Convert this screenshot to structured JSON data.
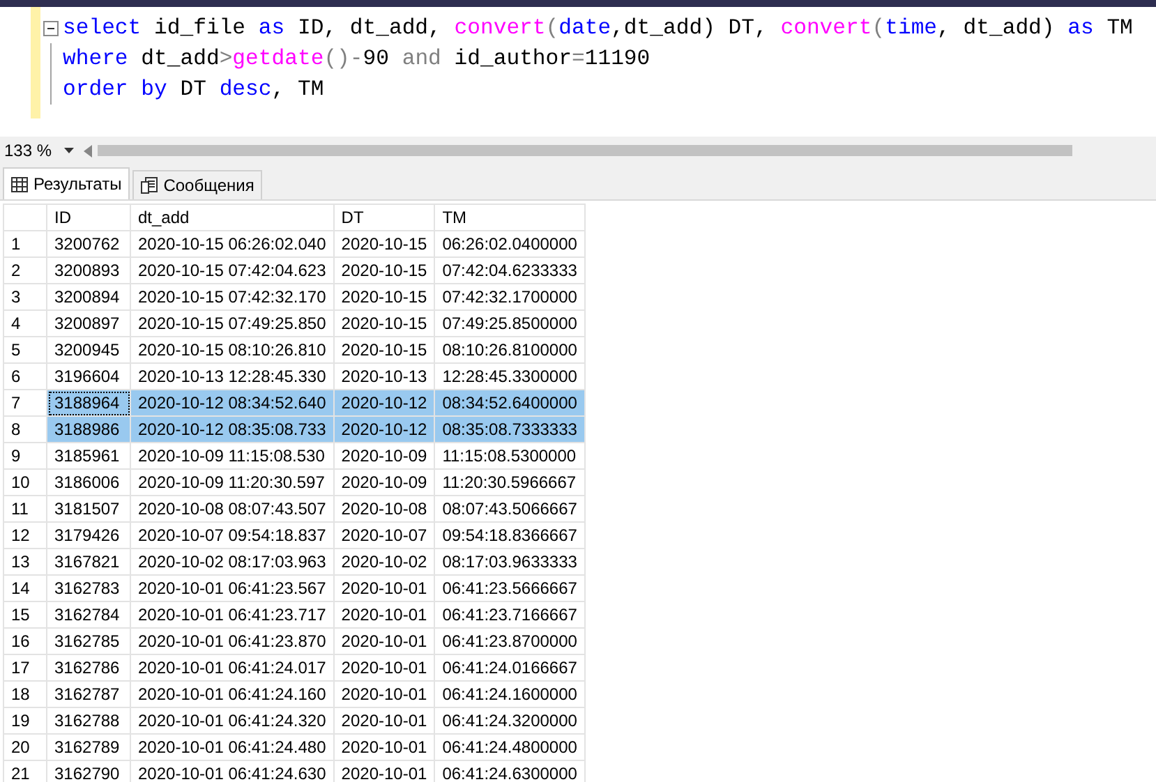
{
  "editor": {
    "lines": [
      {
        "collapsible": true,
        "tokens": [
          {
            "kind": "keyword",
            "text": "select"
          },
          {
            "kind": "plain",
            "text": " id_file "
          },
          {
            "kind": "keyword",
            "text": "as"
          },
          {
            "kind": "plain",
            "text": " ID, dt_add, "
          },
          {
            "kind": "function",
            "text": "convert"
          },
          {
            "kind": "operator",
            "text": "("
          },
          {
            "kind": "keyword",
            "text": "date"
          },
          {
            "kind": "plain",
            "text": ",dt_add) DT, "
          },
          {
            "kind": "function",
            "text": "convert"
          },
          {
            "kind": "operator",
            "text": "("
          },
          {
            "kind": "keyword",
            "text": "time"
          },
          {
            "kind": "plain",
            "text": ", dt_add) "
          },
          {
            "kind": "keyword",
            "text": "as"
          },
          {
            "kind": "plain",
            "text": " TM"
          }
        ]
      },
      {
        "collapsible": false,
        "tokens": [
          {
            "kind": "keyword",
            "text": "where"
          },
          {
            "kind": "plain",
            "text": " dt_add"
          },
          {
            "kind": "operator",
            "text": ">"
          },
          {
            "kind": "function",
            "text": "getdate"
          },
          {
            "kind": "operator",
            "text": "()-"
          },
          {
            "kind": "plain",
            "text": "90 "
          },
          {
            "kind": "operator",
            "text": "and"
          },
          {
            "kind": "plain",
            "text": " id_author"
          },
          {
            "kind": "operator",
            "text": "="
          },
          {
            "kind": "plain",
            "text": "11190"
          }
        ]
      },
      {
        "collapsible": false,
        "tokens": [
          {
            "kind": "keyword",
            "text": "order by"
          },
          {
            "kind": "plain",
            "text": " DT "
          },
          {
            "kind": "keyword",
            "text": "desc"
          },
          {
            "kind": "plain",
            "text": ", TM"
          }
        ]
      }
    ]
  },
  "zoom": {
    "value": "133 %"
  },
  "tabs": [
    {
      "label": "Результаты",
      "selected": true,
      "kind": "grid"
    },
    {
      "label": "Сообщения",
      "selected": false,
      "kind": "messages"
    }
  ],
  "table": {
    "columns": [
      "ID",
      "dt_add",
      "DT",
      "TM"
    ],
    "rows": [
      {
        "n": "1",
        "cells": [
          "3200762",
          "2020-10-15 06:26:02.040",
          "2020-10-15",
          "06:26:02.0400000"
        ],
        "selected": false,
        "focused": false
      },
      {
        "n": "2",
        "cells": [
          "3200893",
          "2020-10-15 07:42:04.623",
          "2020-10-15",
          "07:42:04.6233333"
        ],
        "selected": false,
        "focused": false
      },
      {
        "n": "3",
        "cells": [
          "3200894",
          "2020-10-15 07:42:32.170",
          "2020-10-15",
          "07:42:32.1700000"
        ],
        "selected": false,
        "focused": false
      },
      {
        "n": "4",
        "cells": [
          "3200897",
          "2020-10-15 07:49:25.850",
          "2020-10-15",
          "07:49:25.8500000"
        ],
        "selected": false,
        "focused": false
      },
      {
        "n": "5",
        "cells": [
          "3200945",
          "2020-10-15 08:10:26.810",
          "2020-10-15",
          "08:10:26.8100000"
        ],
        "selected": false,
        "focused": false
      },
      {
        "n": "6",
        "cells": [
          "3196604",
          "2020-10-13 12:28:45.330",
          "2020-10-13",
          "12:28:45.3300000"
        ],
        "selected": false,
        "focused": false
      },
      {
        "n": "7",
        "cells": [
          "3188964",
          "2020-10-12 08:34:52.640",
          "2020-10-12",
          "08:34:52.6400000"
        ],
        "selected": true,
        "focused": true
      },
      {
        "n": "8",
        "cells": [
          "3188986",
          "2020-10-12 08:35:08.733",
          "2020-10-12",
          "08:35:08.7333333"
        ],
        "selected": true,
        "focused": false
      },
      {
        "n": "9",
        "cells": [
          "3185961",
          "2020-10-09 11:15:08.530",
          "2020-10-09",
          "11:15:08.5300000"
        ],
        "selected": false,
        "focused": false
      },
      {
        "n": "10",
        "cells": [
          "3186006",
          "2020-10-09 11:20:30.597",
          "2020-10-09",
          "11:20:30.5966667"
        ],
        "selected": false,
        "focused": false
      },
      {
        "n": "11",
        "cells": [
          "3181507",
          "2020-10-08 08:07:43.507",
          "2020-10-08",
          "08:07:43.5066667"
        ],
        "selected": false,
        "focused": false
      },
      {
        "n": "12",
        "cells": [
          "3179426",
          "2020-10-07 09:54:18.837",
          "2020-10-07",
          "09:54:18.8366667"
        ],
        "selected": false,
        "focused": false
      },
      {
        "n": "13",
        "cells": [
          "3167821",
          "2020-10-02 08:17:03.963",
          "2020-10-02",
          "08:17:03.9633333"
        ],
        "selected": false,
        "focused": false
      },
      {
        "n": "14",
        "cells": [
          "3162783",
          "2020-10-01 06:41:23.567",
          "2020-10-01",
          "06:41:23.5666667"
        ],
        "selected": false,
        "focused": false
      },
      {
        "n": "15",
        "cells": [
          "3162784",
          "2020-10-01 06:41:23.717",
          "2020-10-01",
          "06:41:23.7166667"
        ],
        "selected": false,
        "focused": false
      },
      {
        "n": "16",
        "cells": [
          "3162785",
          "2020-10-01 06:41:23.870",
          "2020-10-01",
          "06:41:23.8700000"
        ],
        "selected": false,
        "focused": false
      },
      {
        "n": "17",
        "cells": [
          "3162786",
          "2020-10-01 06:41:24.017",
          "2020-10-01",
          "06:41:24.0166667"
        ],
        "selected": false,
        "focused": false
      },
      {
        "n": "18",
        "cells": [
          "3162787",
          "2020-10-01 06:41:24.160",
          "2020-10-01",
          "06:41:24.1600000"
        ],
        "selected": false,
        "focused": false
      },
      {
        "n": "19",
        "cells": [
          "3162788",
          "2020-10-01 06:41:24.320",
          "2020-10-01",
          "06:41:24.3200000"
        ],
        "selected": false,
        "focused": false
      },
      {
        "n": "20",
        "cells": [
          "3162789",
          "2020-10-01 06:41:24.480",
          "2020-10-01",
          "06:41:24.4800000"
        ],
        "selected": false,
        "focused": false
      },
      {
        "n": "21",
        "cells": [
          "3162790",
          "2020-10-01 06:41:24.630",
          "2020-10-01",
          "06:41:24.6300000"
        ],
        "selected": false,
        "focused": false
      }
    ]
  }
}
